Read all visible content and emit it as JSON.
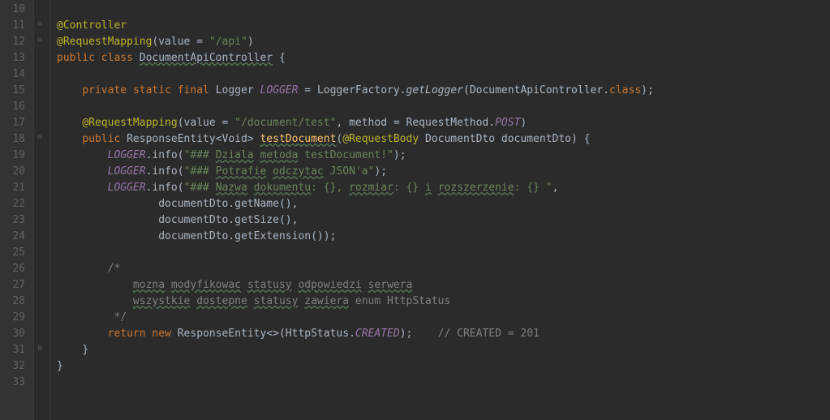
{
  "lineNumbers": [
    "10",
    "11",
    "12",
    "13",
    "14",
    "15",
    "16",
    "17",
    "18",
    "19",
    "20",
    "21",
    "22",
    "23",
    "24",
    "25",
    "26",
    "27",
    "28",
    "29",
    "30",
    "31",
    "32",
    "33"
  ],
  "code": {
    "l11": {
      "anno": "@Controller"
    },
    "l12": {
      "anno": "@RequestMapping",
      "p1": "(",
      "attr": "value",
      "eq": " = ",
      "str": "\"/api\"",
      "p2": ")"
    },
    "l13": {
      "kw1": "public ",
      "kw2": "class ",
      "cls": "DocumentApiController",
      "brace": " {"
    },
    "l15": {
      "kw1": "private ",
      "kw2": "static ",
      "kw3": "final ",
      "type": "Logger ",
      "field": "LOGGER",
      "eq": " = ",
      "factory": "LoggerFactory",
      "dot1": ".",
      "method": "getLogger",
      "p1": "(",
      "arg": "DocumentApiController",
      "dot2": ".",
      "cls": "class",
      "p2": ");"
    },
    "l17": {
      "anno": "@RequestMapping",
      "p1": "(",
      "a1": "value",
      "eq1": " = ",
      "s1": "\"/document/test\"",
      "comma": ", ",
      "a2": "method",
      "eq2": " = ",
      "rm": "RequestMethod",
      "dot": ".",
      "post": "POST",
      "p2": ")"
    },
    "l18": {
      "kw": "public ",
      "ret": "ResponseEntity",
      "lt": "<",
      "void": "Void",
      "gt": "> ",
      "mname": "testDocument",
      "p1": "(",
      "anno": "@RequestBody ",
      "ptype": "DocumentDto ",
      "pname": "documentDto",
      "p2": ") {"
    },
    "l19": {
      "logger": "LOGGER",
      "dot": ".",
      "info": "info",
      "p1": "(",
      "s1": "\"### ",
      "s2": "Dziala",
      "s3": " ",
      "s4": "metoda",
      "s5": " testDocument!\"",
      "p2": ");"
    },
    "l20": {
      "logger": "LOGGER",
      "dot": ".",
      "info": "info",
      "p1": "(",
      "s1": "\"### ",
      "s2": "Potrafie",
      "s3": " ",
      "s4": "odczytac",
      "s5": " JSON'a\"",
      "p2": ");"
    },
    "l21": {
      "logger": "LOGGER",
      "dot": ".",
      "info": "info",
      "p1": "(",
      "s1": "\"### ",
      "s2": "Nazwa",
      "s3": " ",
      "s4": "dokumentu",
      "s5": ": {}, ",
      "s6": "rozmiar",
      "s7": ": {} ",
      "s8": "i",
      "s9": " ",
      "s10": "rozszerzenie",
      "s11": ": {} \"",
      "p2": ","
    },
    "l22": {
      "obj": "documentDto",
      "dot": ".",
      "call": "getName(),"
    },
    "l23": {
      "obj": "documentDto",
      "dot": ".",
      "call": "getSize(),"
    },
    "l24": {
      "obj": "documentDto",
      "dot": ".",
      "call": "getExtension());"
    },
    "l26": {
      "c": "/*"
    },
    "l27": {
      "c1": "mozna",
      "c2": "modyfikowac",
      "c3": "statusy",
      "c4": "odpowiedzi",
      "c5": "serwera"
    },
    "l28": {
      "c1": "wszystkie",
      "c2": "dostepne",
      "c3": "statusy",
      "c4": "zawiera",
      "c5": " enum HttpStatus"
    },
    "l29": {
      "c": " */"
    },
    "l30": {
      "kw1": "return ",
      "kw2": "new ",
      "cls": "ResponseEntity<>",
      "p1": "(",
      "hs": "HttpStatus",
      "dot": ".",
      "created": "CREATED",
      "p2": ");",
      "comment": "    // CREATED = 201"
    },
    "l31": {
      "brace": "}"
    },
    "l32": {
      "brace": "}"
    }
  }
}
